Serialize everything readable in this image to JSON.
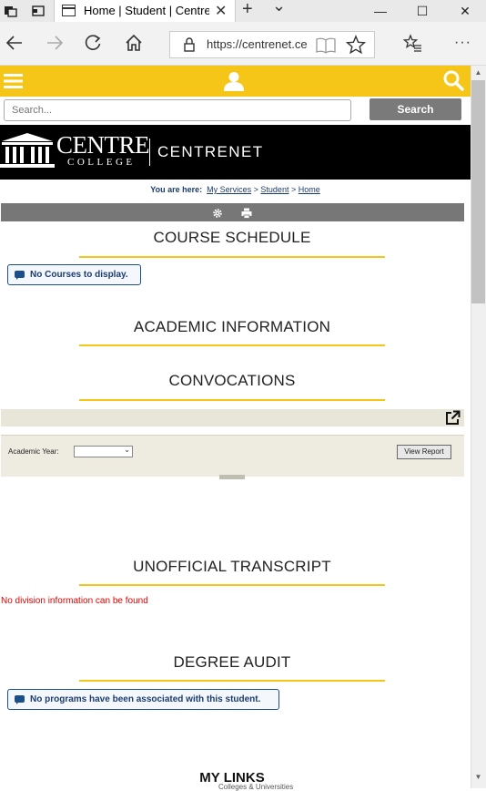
{
  "browser": {
    "tab_title": "Home | Student | Centre",
    "tab_close": "✕",
    "new_tab": "+",
    "tab_list": "⌄",
    "minimize": "—",
    "maximize": "☐",
    "close": "✕",
    "url": "https://centrenet.ce",
    "more": "···"
  },
  "site": {
    "search_placeholder": "Search...",
    "search_button": "Search",
    "brand_centre": "CENTRE",
    "brand_college": "COLLEGE",
    "brand_app": "CENTRENET"
  },
  "breadcrumb": {
    "prefix": "You are here:",
    "items": [
      "My Services",
      "Student",
      "Home"
    ],
    "separator": ">"
  },
  "sections": {
    "course_schedule": {
      "title": "COURSE SCHEDULE",
      "message": "No Courses to display."
    },
    "academic_information": {
      "title": "ACADEMIC INFORMATION"
    },
    "convocations": {
      "title": "CONVOCATIONS",
      "year_label": "Academic Year:",
      "year_value": "",
      "view_report": "View Report"
    },
    "unofficial_transcript": {
      "title": "UNOFFICIAL TRANSCRIPT",
      "message": "No division information can be found"
    },
    "degree_audit": {
      "title": "DEGREE AUDIT",
      "message": "No programs have been associated with this student."
    },
    "my_links": {
      "title": "MY LINKS",
      "subtitle": "Colleges & Universities"
    }
  },
  "colors": {
    "accent_yellow": "#f5c518",
    "brand_black": "#000000",
    "link_blue": "#1b3c6e",
    "error_red": "#e00000",
    "toolbar_gray": "#777777"
  },
  "icons": [
    "tab-actions-icon",
    "tab-preview-icon",
    "page-icon",
    "back-icon",
    "forward-icon",
    "refresh-icon",
    "home-icon",
    "lock-icon",
    "reading-view-icon",
    "favorite-star-icon",
    "favorites-hub-icon",
    "hamburger-menu-icon",
    "user-icon",
    "search-icon",
    "gear-icon",
    "print-icon",
    "external-link-icon",
    "message-bubble-icon"
  ]
}
